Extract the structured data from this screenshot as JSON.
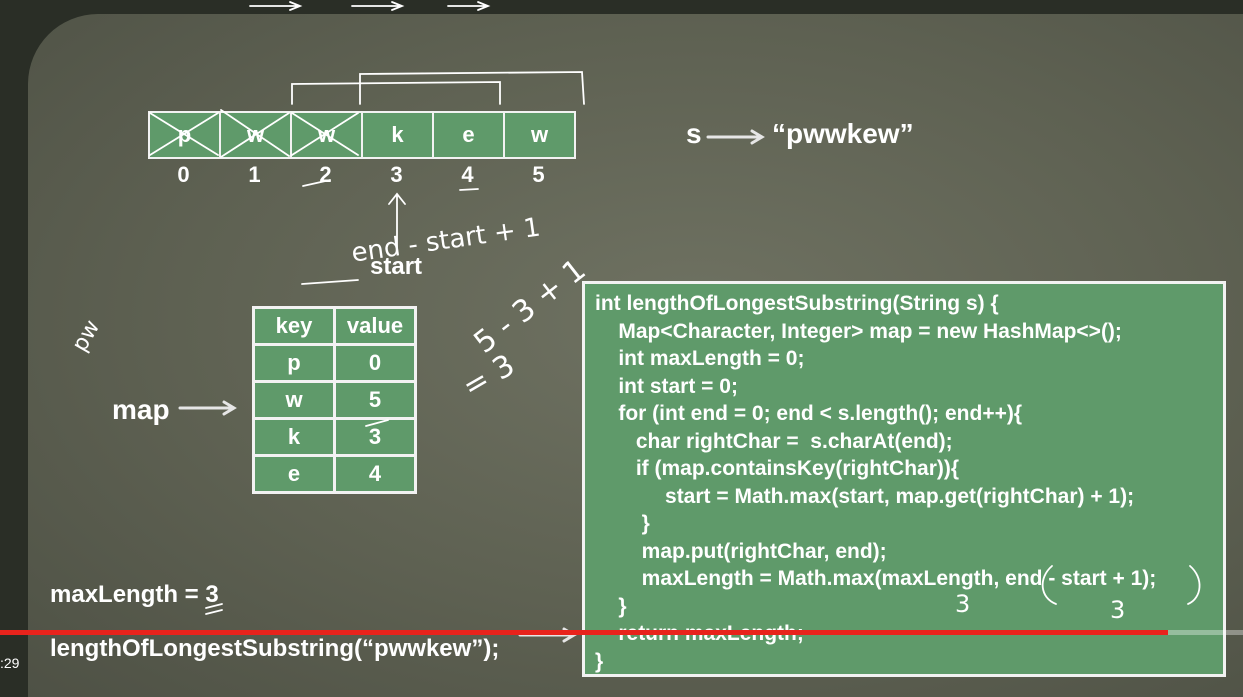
{
  "string_label": "s",
  "string_value": "“pwwkew”",
  "array": {
    "chars": [
      "p",
      "w",
      "w",
      "k",
      "e",
      "w"
    ],
    "indices": [
      "0",
      "1",
      "2",
      "3",
      "4",
      "5"
    ]
  },
  "start_label": "start",
  "map_label": "map",
  "map_table": {
    "headers": [
      "key",
      "value"
    ],
    "rows": [
      [
        "p",
        "0"
      ],
      [
        "w",
        "5"
      ],
      [
        "k",
        "3"
      ],
      [
        "e",
        "4"
      ]
    ]
  },
  "code": {
    "lines": [
      "int lengthOfLongestSubstring(String s) {",
      "    Map<Character, Integer> map = new HashMap<>();",
      "    int maxLength = 0;",
      "    int start = 0;",
      "    for (int end = 0; end < s.length(); end++){",
      "       char rightChar =  s.charAt(end);",
      "       if (map.containsKey(rightChar)){",
      "            start = Math.max(start, map.get(rightChar) + 1);",
      "        }",
      "        map.put(rightChar, end);",
      "        maxLength = Math.max(maxLength, end - start + 1);",
      "    }",
      "    return maxLength;",
      "}"
    ]
  },
  "max_length_text": "maxLength = 3",
  "call_text": "lengthOfLongestSubstring(“pwwkew”);",
  "annotations": {
    "formula": "end - start + 1",
    "calc": "5 - 3 + 1",
    "result": "= 3",
    "side_note": "pw",
    "three_a": "3",
    "three_b": "3"
  },
  "player": {
    "time": ":29",
    "progress_fraction": 0.94,
    "progress_color": "#e8231c"
  }
}
